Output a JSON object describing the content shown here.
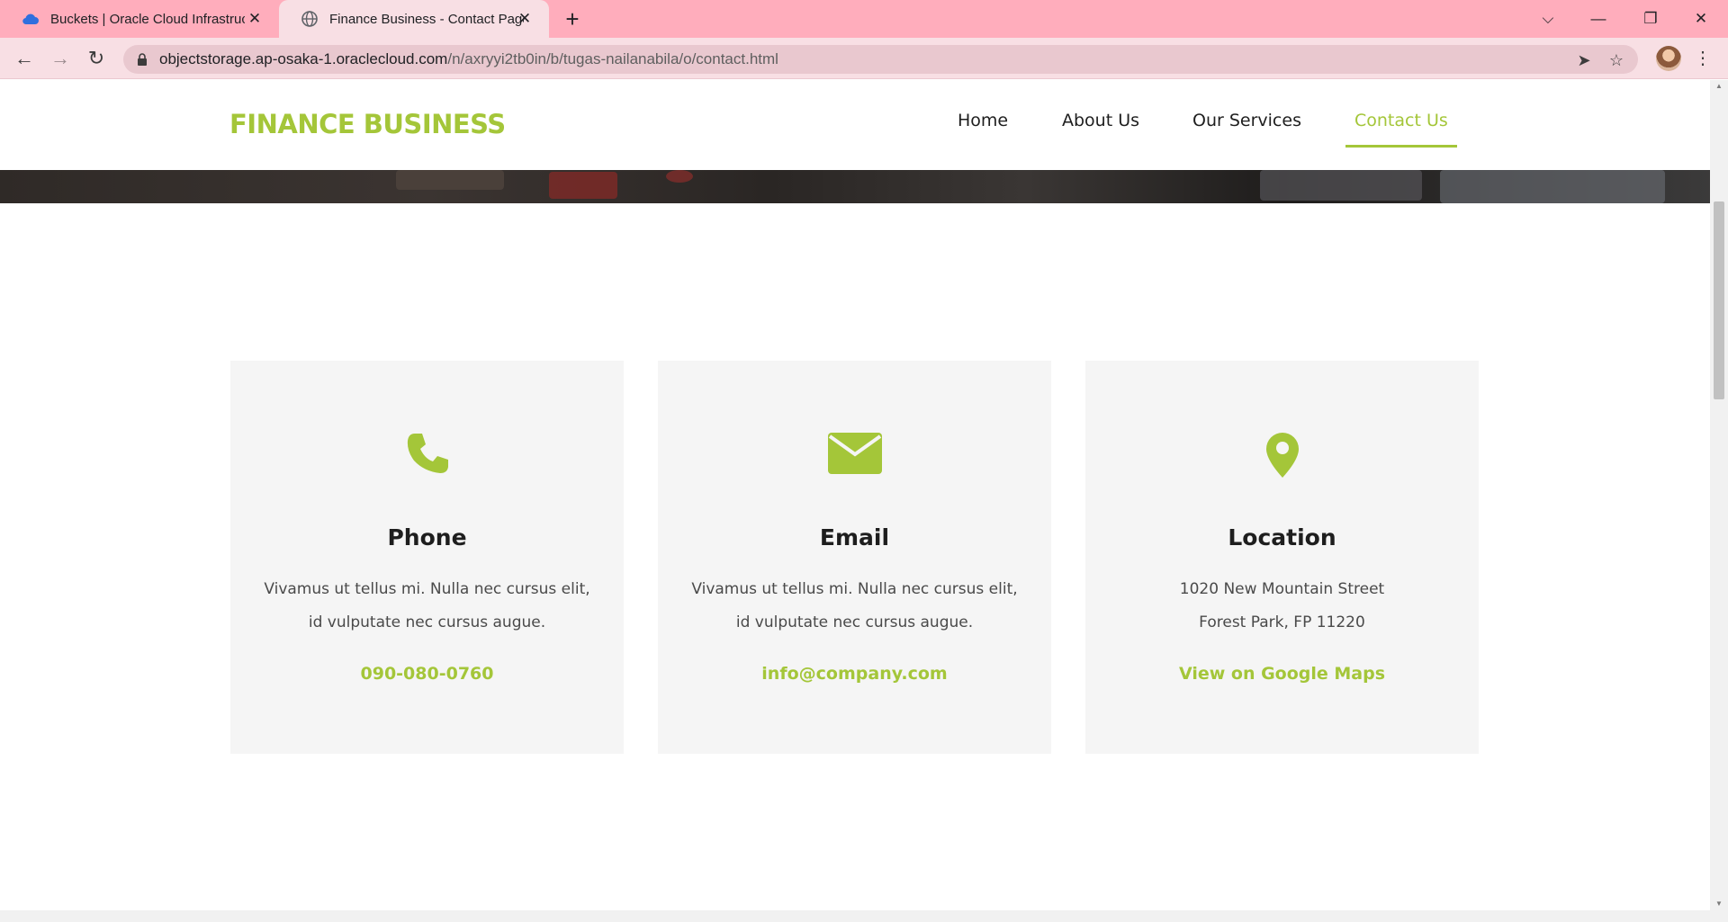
{
  "browser": {
    "tabs": [
      {
        "title": "Buckets | Oracle Cloud Infrastruct",
        "favicon": "cloud-icon",
        "active": false
      },
      {
        "title": "Finance Business - Contact Page",
        "favicon": "globe-icon",
        "active": true
      }
    ],
    "url_host": "objectstorage.ap-osaka-1.oraclecloud.com",
    "url_path": "/n/axryyi2tb0in/b/tugas-nailanabila/o/contact.html",
    "tabbar_color": "#ffadbc",
    "toolbar_color": "#f8dfe4"
  },
  "site": {
    "logo": "FINANCE BUSINESS",
    "accent_color": "#a4c639",
    "nav": [
      {
        "label": "Home",
        "active": false
      },
      {
        "label": "About Us",
        "active": false
      },
      {
        "label": "Our Services",
        "active": false
      },
      {
        "label": "Contact Us",
        "active": true
      }
    ]
  },
  "cards": [
    {
      "icon": "phone-icon",
      "heading": "Phone",
      "line1": "Vivamus ut tellus mi. Nulla nec cursus elit,",
      "line2": "id vulputate nec cursus augue.",
      "link": "090-080-0760"
    },
    {
      "icon": "envelope-icon",
      "heading": "Email",
      "line1": "Vivamus ut tellus mi. Nulla nec cursus elit,",
      "line2": "id vulputate nec cursus augue.",
      "link": "info@company.com"
    },
    {
      "icon": "map-pin-icon",
      "heading": "Location",
      "line1": "1020 New Mountain Street",
      "line2": "Forest Park, FP 11220",
      "link": "View on Google Maps"
    }
  ]
}
